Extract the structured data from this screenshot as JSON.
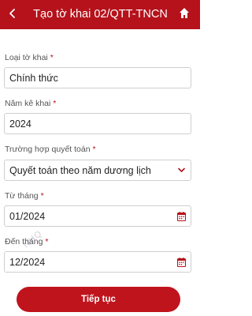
{
  "header": {
    "title": "Tạo tờ khai 02/QTT-TNCN",
    "back_icon": "chevron-left-icon",
    "home_icon": "home-icon",
    "bg_color": "#b5121b"
  },
  "form": {
    "loai_to_khai": {
      "label": "Loại tờ khai",
      "required": "*",
      "value": "Chính thức"
    },
    "nam_ke_khai": {
      "label": "Năm kê khai",
      "required": "*",
      "value": "2024"
    },
    "truong_hop": {
      "label": "Trường hợp quyết toán",
      "required": "*",
      "value": "Quyết toán theo năm dương lịch",
      "icon": "chevron-down-icon"
    },
    "tu_thang": {
      "label": "Từ tháng",
      "required": "*",
      "value": "01/2024",
      "icon": "calendar-icon"
    },
    "den_thang": {
      "label": "Đến tháng",
      "required": "*",
      "value": "12/2024",
      "icon": "calendar-icon"
    }
  },
  "submit_label": "Tiếp tục",
  "watermark_text": "NHQ",
  "accent_color": "#c0141d"
}
